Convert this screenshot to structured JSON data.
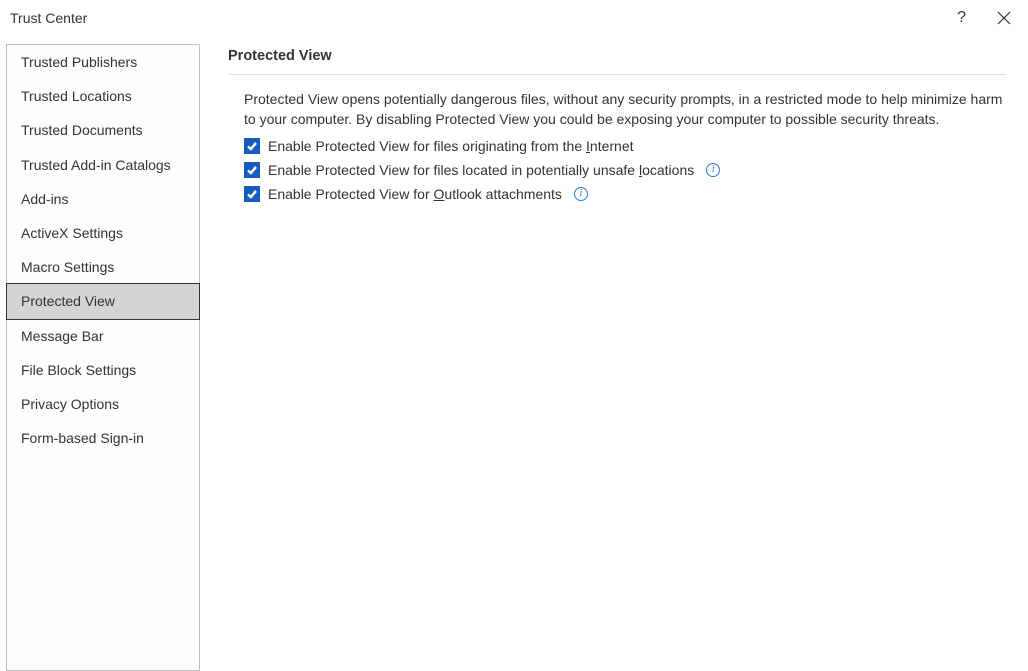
{
  "window": {
    "title": "Trust Center"
  },
  "sidebar": {
    "items": [
      {
        "label": "Trusted Publishers",
        "selected": false
      },
      {
        "label": "Trusted Locations",
        "selected": false
      },
      {
        "label": "Trusted Documents",
        "selected": false
      },
      {
        "label": "Trusted Add-in Catalogs",
        "selected": false
      },
      {
        "label": "Add-ins",
        "selected": false
      },
      {
        "label": "ActiveX Settings",
        "selected": false
      },
      {
        "label": "Macro Settings",
        "selected": false
      },
      {
        "label": "Protected View",
        "selected": true
      },
      {
        "label": "Message Bar",
        "selected": false
      },
      {
        "label": "File Block Settings",
        "selected": false
      },
      {
        "label": "Privacy Options",
        "selected": false
      },
      {
        "label": "Form-based Sign-in",
        "selected": false
      }
    ]
  },
  "content": {
    "section_title": "Protected View",
    "description": "Protected View opens potentially dangerous files, without any security prompts, in a restricted mode to help minimize harm to your computer. By disabling Protected View you could be exposing your computer to possible security threats.",
    "options": [
      {
        "checked": true,
        "label_pre": "Enable Protected View for files originating from the ",
        "accel": "I",
        "label_post": "nternet",
        "info": false
      },
      {
        "checked": true,
        "label_pre": "Enable Protected View for files located in potentially unsafe ",
        "accel": "l",
        "label_post": "ocations",
        "info": true
      },
      {
        "checked": true,
        "label_pre": "Enable Protected View for ",
        "accel": "O",
        "label_post": "utlook attachments",
        "info": true
      }
    ]
  }
}
